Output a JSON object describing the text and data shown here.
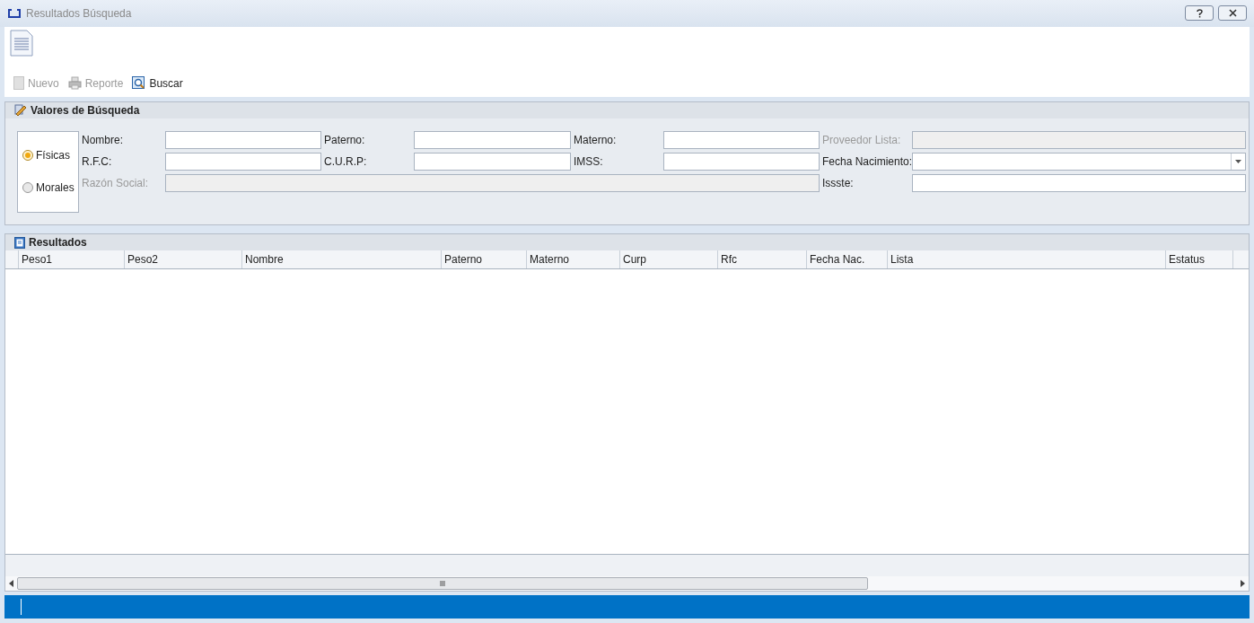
{
  "window": {
    "title": "Resultados Búsqueda"
  },
  "toolbar": [
    {
      "label": "Nuevo",
      "kind": "blank",
      "disabled": true
    },
    {
      "label": "Reporte",
      "kind": "printer",
      "disabled": true
    },
    {
      "label": "Buscar",
      "kind": "search",
      "disabled": false
    }
  ],
  "search_group": {
    "title": "Valores de Búsqueda",
    "radios": [
      {
        "label": "Físicas",
        "selected": true
      },
      {
        "label": "Morales",
        "selected": false
      }
    ],
    "fields": [
      {
        "label": "Nombre:",
        "kind": "text",
        "disabled": false
      },
      {
        "label": "Paterno:",
        "kind": "text",
        "disabled": false
      },
      {
        "label": "Materno:",
        "kind": "text",
        "disabled": false
      },
      {
        "label": "Proveedor Lista:",
        "kind": "text",
        "disabled": true
      },
      {
        "label": "R.F.C:",
        "kind": "text",
        "disabled": false
      },
      {
        "label": "C.U.R.P:",
        "kind": "text",
        "disabled": false
      },
      {
        "label": "IMSS:",
        "kind": "text",
        "disabled": false
      },
      {
        "label": "Fecha Nacimiento:",
        "kind": "dropdown",
        "disabled": false
      },
      {
        "label": "Razón Social:",
        "kind": "wide",
        "disabled": true
      },
      {
        "label": "Issste:",
        "kind": "text",
        "disabled": false
      }
    ]
  },
  "results": {
    "title": "Resultados",
    "columns": [
      "Peso1",
      "Peso2",
      "Nombre",
      "Paterno",
      "Materno",
      "Curp",
      "Rfc",
      "Fecha Nac.",
      "Lista",
      "Estatus"
    ]
  }
}
